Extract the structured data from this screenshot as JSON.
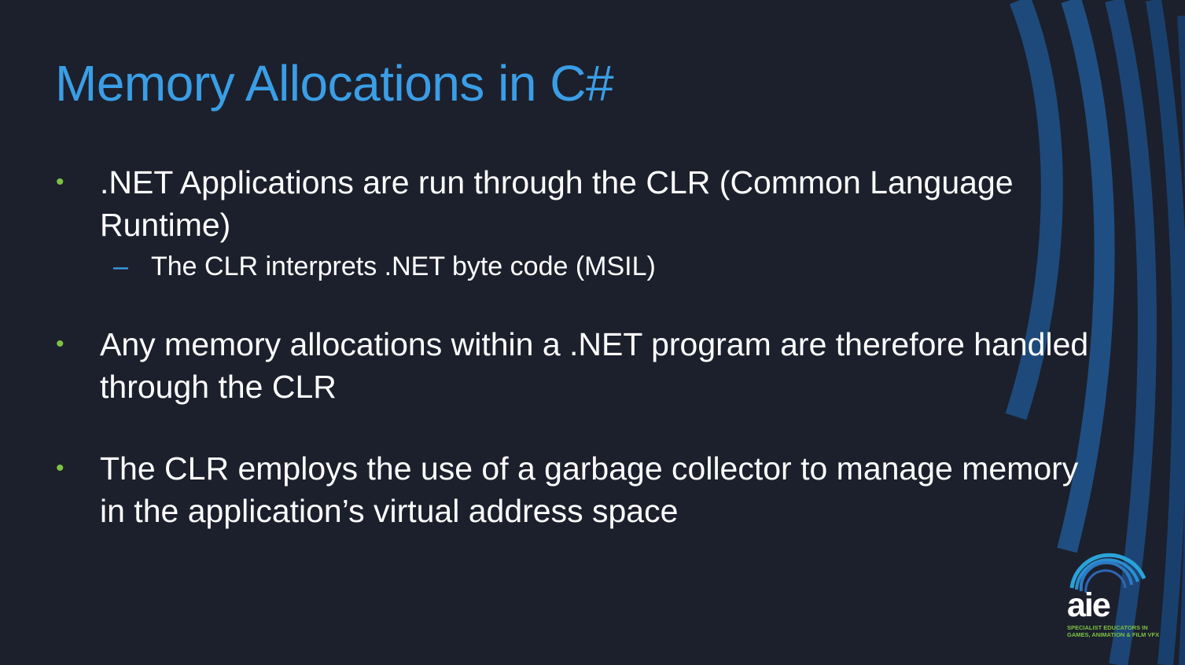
{
  "slide": {
    "title": "Memory Allocations in C#",
    "bullets": [
      {
        "marker": "•",
        "text": ".NET Applications are run through the CLR (Common Language Runtime)",
        "sub_items": [
          {
            "marker": "–",
            "text": "The CLR interprets .NET byte code (MSIL)"
          }
        ]
      },
      {
        "marker": "•",
        "text": "Any memory allocations within a .NET program are therefore handled through the CLR"
      },
      {
        "marker": "•",
        "text": "The CLR employs the use of a garbage collector to manage memory in the application’s virtual address space"
      }
    ]
  },
  "logo": {
    "word": "aie",
    "tagline_line1": "SPECIALIST EDUCATORS IN",
    "tagline_line2": "GAMES, ANIMATION & FILM VFX"
  },
  "colors": {
    "background": "#1c202c",
    "title": "#3a9ee6",
    "bullet_marker": "#7cc242",
    "sub_marker": "#3a9ee6",
    "text": "#ffffff",
    "decor_arcs": "#1f4f82",
    "logo_accent": "#2aa3d9"
  }
}
